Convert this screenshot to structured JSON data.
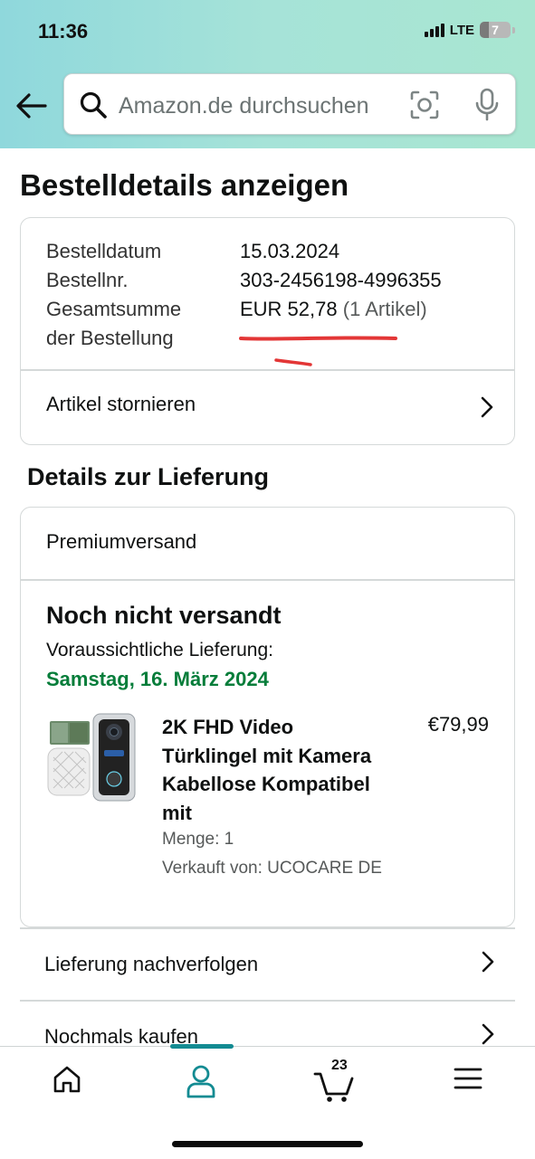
{
  "status_bar": {
    "time": "11:36",
    "network": "LTE",
    "battery": "7"
  },
  "search": {
    "placeholder": "Amazon.de durchsuchen"
  },
  "page": {
    "title": "Bestelldetails anzeigen"
  },
  "order_summary": {
    "rows": [
      {
        "label": "Bestelldatum",
        "value": "15.03.2024"
      },
      {
        "label": "Bestellnr.",
        "value": "303-2456198-4996355"
      }
    ],
    "total_label_1": "Gesamtsumme",
    "total_label_2": "der Bestellung",
    "total_value": "EUR 52,78",
    "total_items": "(1 Artikel)",
    "cancel_label": "Artikel stornieren"
  },
  "delivery": {
    "section_title": "Details zur Lieferung",
    "shipping_method": "Premiumversand",
    "status": "Noch nicht versandt",
    "eta_label": "Voraussichtliche Lieferung:",
    "eta_date": "Samstag, 16. März 2024",
    "item": {
      "title": "2K FHD Video Türklingel mit Kamera Kabellose Kompatibel mit",
      "price": "€79,99",
      "quantity": "Menge: 1",
      "seller": "Verkauft von: UCOCARE DE"
    }
  },
  "actions": {
    "track": "Lieferung nachverfolgen",
    "buy_again": "Nochmals kaufen"
  },
  "bottom_nav": {
    "cart_count": "23",
    "active": "account"
  },
  "colors": {
    "accent": "#138b92",
    "eta_green": "#067d3a",
    "annotation_red": "#e02020"
  }
}
